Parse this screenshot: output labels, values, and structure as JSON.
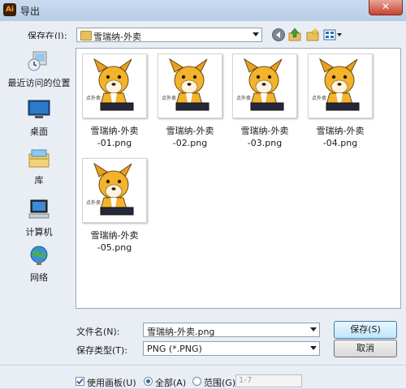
{
  "window": {
    "app_icon": "Ai",
    "title": "导出",
    "close_glyph": "✕"
  },
  "toolbar": {
    "save_in_label": "保存在(I):",
    "folder": "雪瑞纳-外卖",
    "icons": [
      "back-icon",
      "up-folder-icon",
      "new-folder-icon",
      "view-menu-icon"
    ]
  },
  "places": [
    {
      "label": "最近访问的位置",
      "icon": "recent-places-icon"
    },
    {
      "label": "桌面",
      "icon": "desktop-icon"
    },
    {
      "label": "库",
      "icon": "libraries-icon"
    },
    {
      "label": "计算机",
      "icon": "computer-icon"
    },
    {
      "label": "网络",
      "icon": "network-icon"
    }
  ],
  "files": [
    {
      "line1": "雪瑞纳-外卖",
      "line2": "-01.png"
    },
    {
      "line1": "雪瑞纳-外卖",
      "line2": "-02.png"
    },
    {
      "line1": "雪瑞纳-外卖",
      "line2": "-03.png"
    },
    {
      "line1": "雪瑞纳-外卖",
      "line2": "-04.png"
    },
    {
      "line1": "雪瑞纳-外卖",
      "line2": "-05.png"
    }
  ],
  "thumbnail_caption": "点外卖",
  "form": {
    "filename_label": "文件名(N):",
    "filename_value": "雪瑞纳-外卖.png",
    "filetype_label": "保存类型(T):",
    "filetype_value": "PNG (*.PNG)",
    "save_button": "保存(S)",
    "cancel_button": "取消"
  },
  "options": {
    "use_artboards_label": "使用画板(U)",
    "use_artboards_checked": true,
    "all_label": "全部(A)",
    "range_label": "范围(G)",
    "range_value": "1-7",
    "selected": "all"
  },
  "colors": {
    "accent": "#2a6ab8",
    "close": "#c7432f"
  }
}
